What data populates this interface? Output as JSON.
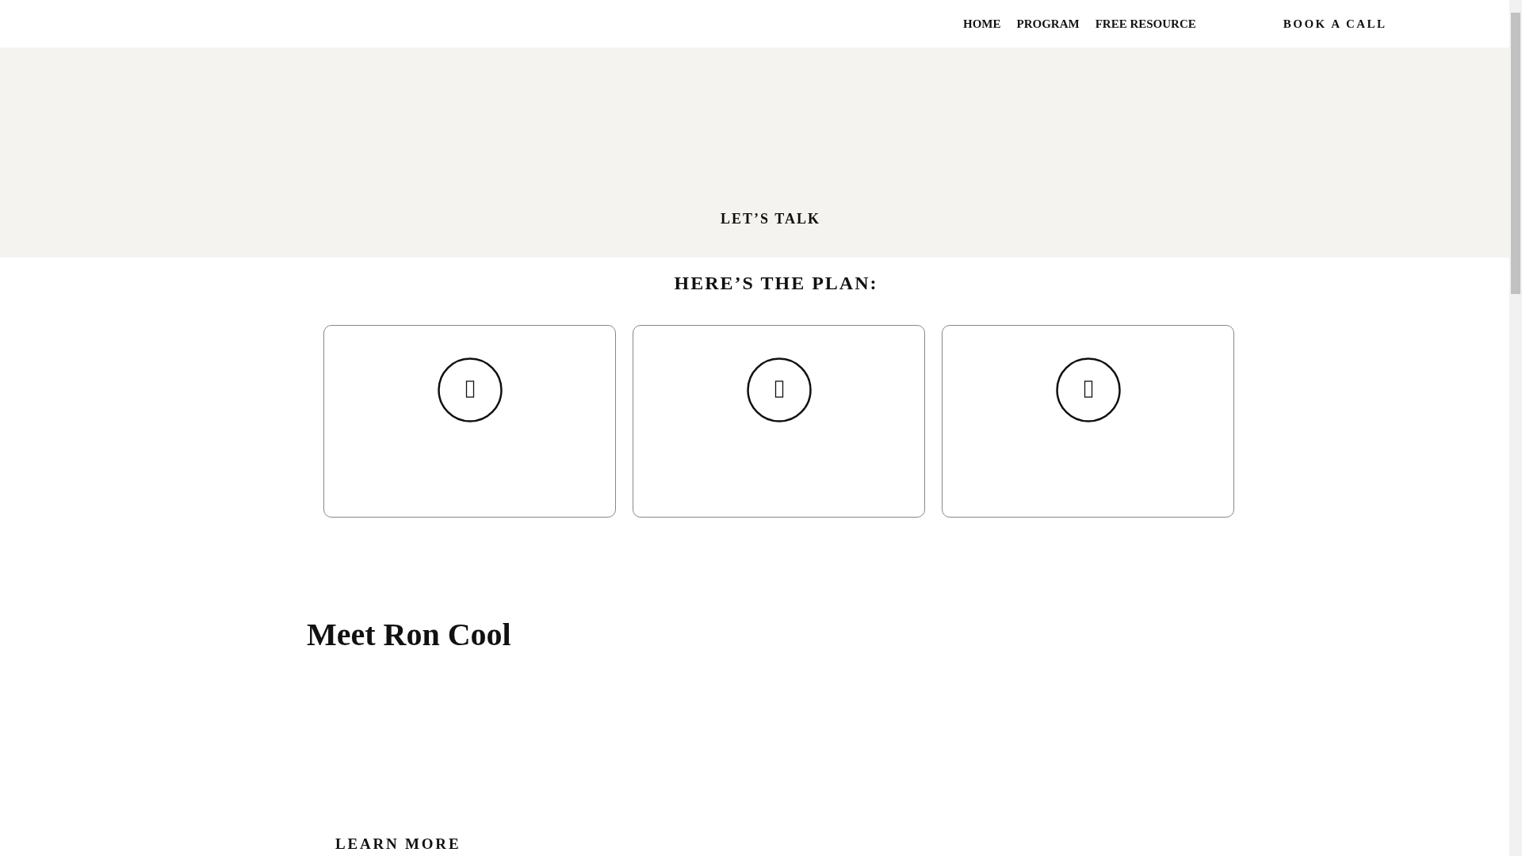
{
  "nav": {
    "links": [
      {
        "label": "HOME"
      },
      {
        "label": "PROGRAM"
      },
      {
        "label": "FREE RESOURCE"
      }
    ],
    "cta": "BOOK A CALL"
  },
  "hero": {
    "button": "LET’S TALK"
  },
  "plan": {
    "title": "HERE’S THE PLAN:",
    "cards": [
      {
        "kind": "step"
      },
      {
        "kind": "step"
      },
      {
        "kind": "step"
      }
    ]
  },
  "about": {
    "title": "Meet Ron Cool",
    "button": "LEARN MORE"
  }
}
